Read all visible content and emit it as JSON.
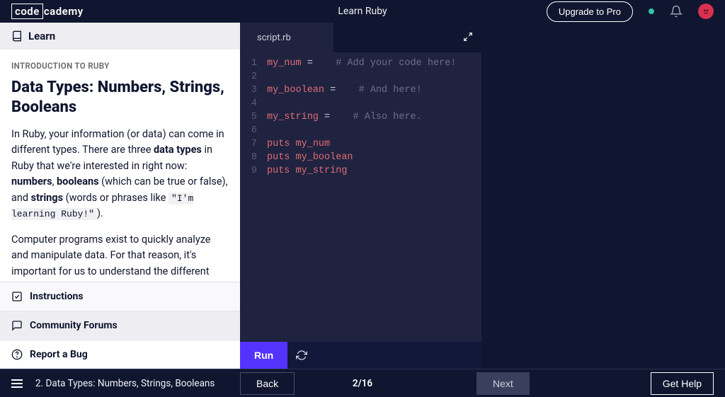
{
  "header": {
    "logo_boxed": "code",
    "logo_rest": "cademy",
    "course_title": "Learn Ruby",
    "upgrade_label": "Upgrade to Pro"
  },
  "lesson": {
    "learn_tab": "Learn",
    "intro_label": "INTRODUCTION TO RUBY",
    "title": "Data Types: Numbers, Strings, Booleans",
    "p1_a": "In Ruby, your information (or data) can come in different types. There are three ",
    "p1_b1": "data types",
    "p1_c": " in Ruby that we're interested in right now: ",
    "p1_b2": "numbers",
    "p1_d": ", ",
    "p1_b3": "booleans",
    "p1_e": " (which can be true or false), and ",
    "p1_b4": "strings",
    "p1_f": " (words or phrases like ",
    "p1_code": "\"I'm learning Ruby!\"",
    "p1_g": ").",
    "p2": "Computer programs exist to quickly analyze and manipulate data. For that reason, it's important for us to understand the different data types that we can use in our programs.",
    "instructions_label": "Instructions",
    "forums_label": "Community Forums",
    "bug_label": "Report a Bug"
  },
  "editor": {
    "filename": "script.rb",
    "line_numbers": [
      "1",
      "2",
      "3",
      "4",
      "5",
      "6",
      "7",
      "8",
      "9"
    ],
    "lines": {
      "l1_var": "my_num",
      "l1_eq": " =    ",
      "l1_comment": "# Add your code here!",
      "l3_var": "my_boolean",
      "l3_eq": " =    ",
      "l3_comment": "# And here!",
      "l5_var": "my_string",
      "l5_eq": " =    ",
      "l5_comment": "# Also here.",
      "l7_kw": "puts",
      "l7_sp": " ",
      "l7_var": "my_num",
      "l8_kw": "puts",
      "l8_sp": " ",
      "l8_var": "my_boolean",
      "l9_kw": "puts",
      "l9_sp": " ",
      "l9_var": "my_string"
    },
    "run_label": "Run"
  },
  "footer": {
    "lesson_name": "2. Data Types: Numbers, Strings, Booleans",
    "back_label": "Back",
    "progress": "2/16",
    "next_label": "Next",
    "help_label": "Get Help"
  }
}
